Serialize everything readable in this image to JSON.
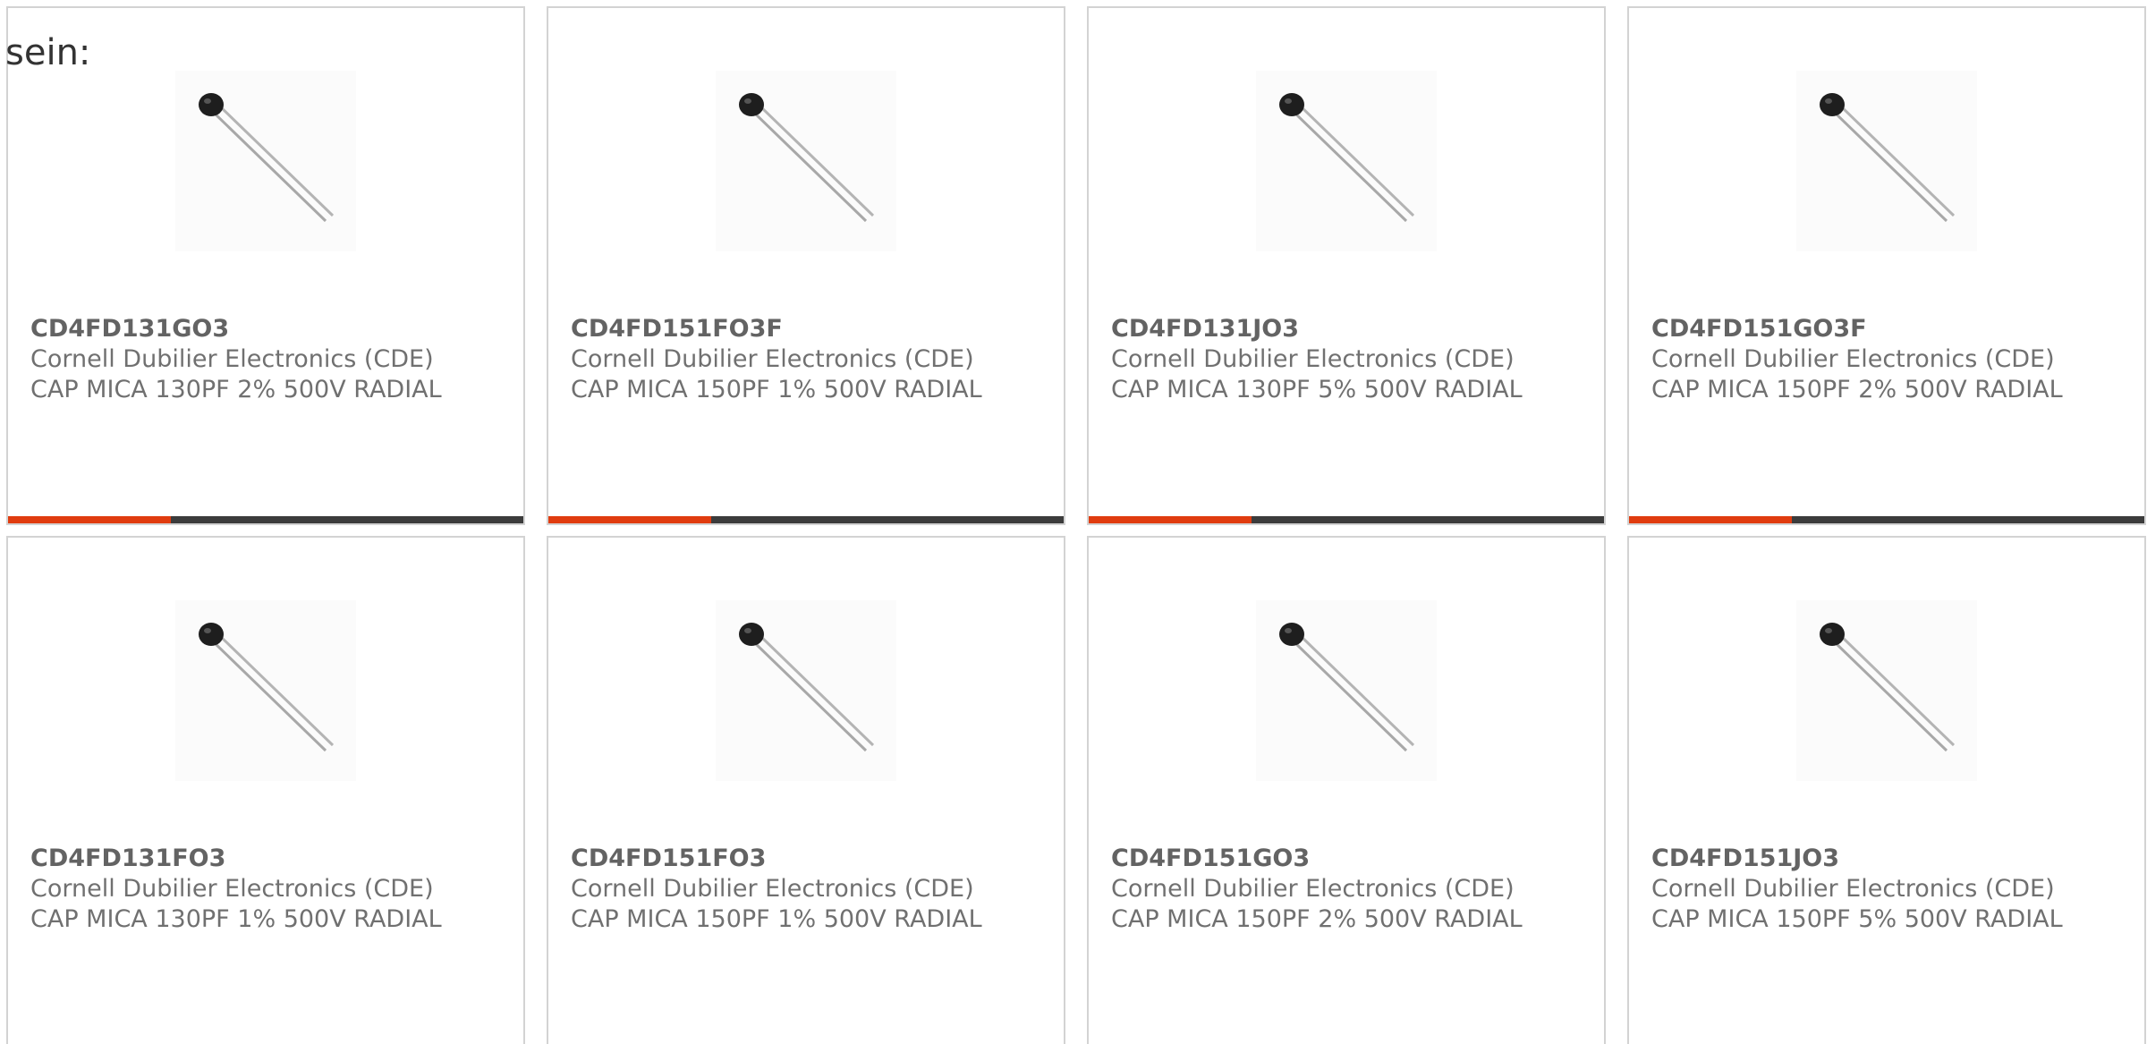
{
  "intro_text": "sein:",
  "colors": {
    "accent": "#e03c0f",
    "bar": "#3c3c3c",
    "border": "#d3d3d3"
  },
  "products": [
    {
      "part_number": "CD4FD131GO3",
      "manufacturer": "Cornell Dubilier Electronics (CDE)",
      "description": "CAP MICA 130PF 2% 500V RADIAL",
      "image_icon": "radial-capacitor-icon"
    },
    {
      "part_number": "CD4FD151FO3F",
      "manufacturer": "Cornell Dubilier Electronics (CDE)",
      "description": "CAP MICA 150PF 1% 500V RADIAL",
      "image_icon": "radial-capacitor-icon"
    },
    {
      "part_number": "CD4FD131JO3",
      "manufacturer": "Cornell Dubilier Electronics (CDE)",
      "description": "CAP MICA 130PF 5% 500V RADIAL",
      "image_icon": "radial-capacitor-icon"
    },
    {
      "part_number": "CD4FD151GO3F",
      "manufacturer": "Cornell Dubilier Electronics (CDE)",
      "description": "CAP MICA 150PF 2% 500V RADIAL",
      "image_icon": "radial-capacitor-icon"
    },
    {
      "part_number": "CD4FD131FO3",
      "manufacturer": "Cornell Dubilier Electronics (CDE)",
      "description": "CAP MICA 130PF 1% 500V RADIAL",
      "image_icon": "radial-capacitor-icon"
    },
    {
      "part_number": "CD4FD151FO3",
      "manufacturer": "Cornell Dubilier Electronics (CDE)",
      "description": "CAP MICA 150PF 1% 500V RADIAL",
      "image_icon": "radial-capacitor-icon"
    },
    {
      "part_number": "CD4FD151GO3",
      "manufacturer": "Cornell Dubilier Electronics (CDE)",
      "description": "CAP MICA 150PF 2% 500V RADIAL",
      "image_icon": "radial-capacitor-icon"
    },
    {
      "part_number": "CD4FD151JO3",
      "manufacturer": "Cornell Dubilier Electronics (CDE)",
      "description": "CAP MICA 150PF 5% 500V RADIAL",
      "image_icon": "radial-capacitor-icon"
    }
  ]
}
